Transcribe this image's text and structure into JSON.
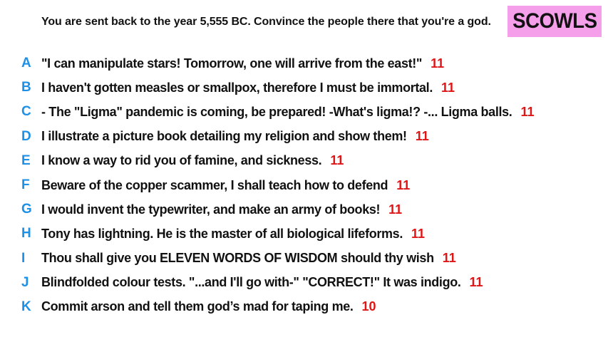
{
  "prompt": "You are sent back to the year 5,555 BC. Convince the people there that you're a god.",
  "logo": "SCOWLS",
  "colors": {
    "logo_background": "#f59ee9",
    "letter": "#1e90e6",
    "score": "#e01515",
    "text": "#111111"
  },
  "answers": [
    {
      "letter": "A",
      "text": "\"I can manipulate stars! Tomorrow, one will arrive from the east!\"",
      "score": "11"
    },
    {
      "letter": "B",
      "text": "I haven't gotten measles or smallpox, therefore I must be immortal.",
      "score": "11"
    },
    {
      "letter": "C",
      "text": "- The \"Ligma\" pandemic is coming, be prepared! -What's ligma!?  -... Ligma balls.",
      "score": "11"
    },
    {
      "letter": "D",
      "text": "I illustrate a picture book detailing my religion and show them!",
      "score": "11"
    },
    {
      "letter": "E",
      "text": "I know a way to rid you of famine, and sickness.",
      "score": "11"
    },
    {
      "letter": "F",
      "text": "Beware of the copper scammer, I shall teach how to defend",
      "score": "11"
    },
    {
      "letter": "G",
      "text": "I would invent the typewriter, and make an army of books!",
      "score": "11"
    },
    {
      "letter": "H",
      "text": "Tony has lightning. He is the master of all biological lifeforms.",
      "score": "11"
    },
    {
      "letter": "I",
      "text": "Thou shall give you ELEVEN WORDS OF WISDOM should thy wish",
      "score": "11"
    },
    {
      "letter": "J",
      "text": "Blindfolded colour tests. \"...and I'll go with-\" \"CORRECT!\" It was indigo.",
      "score": "11"
    },
    {
      "letter": "K",
      "text": "Commit arson and tell them god’s mad for taping me.",
      "score": "10"
    }
  ]
}
